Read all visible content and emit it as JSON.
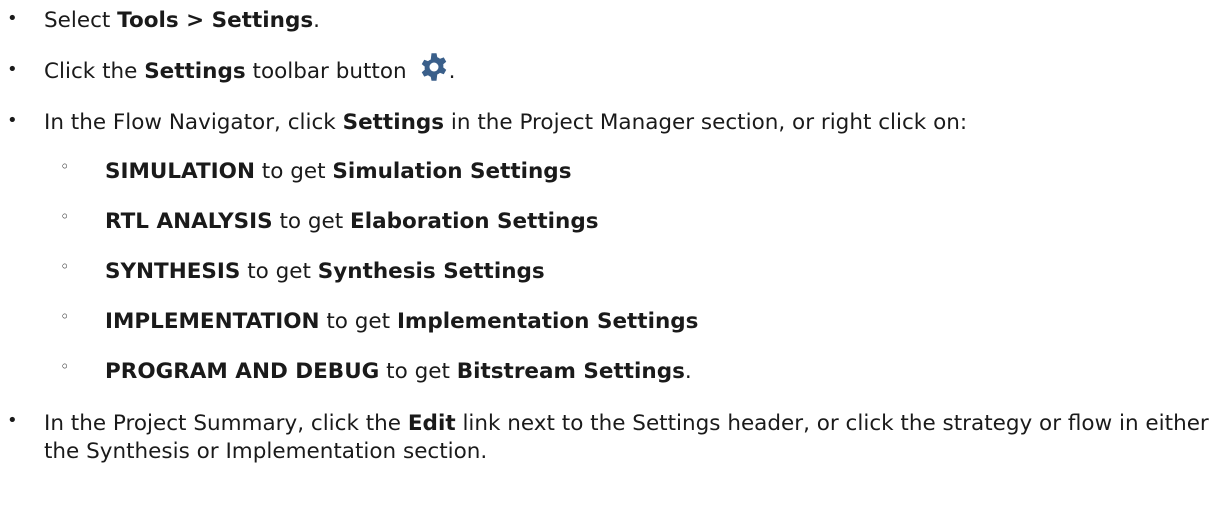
{
  "bullets": [
    {
      "prefix": "Select ",
      "bold": "Tools > Settings",
      "suffix": "."
    },
    {
      "prefix": "Click the ",
      "bold": "Settings",
      "suffix": " toolbar button",
      "icon": "gear-icon",
      "icon_color": "#3a5f8a",
      "after_icon": "."
    },
    {
      "prefix": "In the Flow Navigator, click ",
      "bold": "Settings",
      "suffix": " in the Project Manager section, or right click on:"
    },
    {
      "prefix": "In the Project Summary, click the ",
      "bold": "Edit",
      "suffix": " link next to the Settings header, or click the strategy or flow in either the Synthesis or Implementation section."
    }
  ],
  "sub_bullets": [
    {
      "stage": "SIMULATION",
      "mid": " to get ",
      "settings": "Simulation Settings",
      "end": ""
    },
    {
      "stage": "RTL ANALYSIS",
      "mid": " to get ",
      "settings": "Elaboration Settings",
      "end": ""
    },
    {
      "stage": "SYNTHESIS",
      "mid": " to get ",
      "settings": "Synthesis Settings",
      "end": ""
    },
    {
      "stage": "IMPLEMENTATION",
      "mid": " to get ",
      "settings": "Implementation Settings",
      "end": ""
    },
    {
      "stage": "PROGRAM AND DEBUG",
      "mid": " to get ",
      "settings": "Bitstream Settings",
      "end": "."
    }
  ],
  "bullet_glyph": "•",
  "sub_bullet_glyph": "◦"
}
